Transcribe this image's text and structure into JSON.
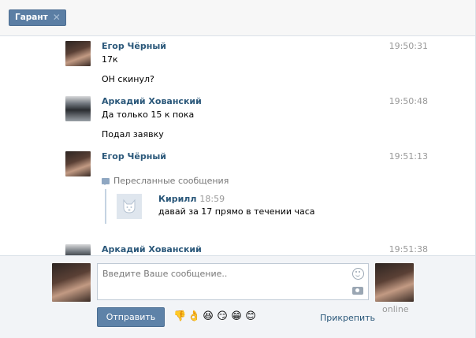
{
  "tab": {
    "label": "Гарант",
    "close_icon": "close-icon"
  },
  "messages": [
    {
      "author": "Егор Чёрный",
      "time": "19:50:31",
      "avatar": "girl-avatar",
      "lines": [
        "17к",
        "ОН скинул?"
      ]
    },
    {
      "author": "Аркадий Хованский",
      "time": "19:50:48",
      "avatar": "laptop-avatar",
      "lines": [
        "Да только 15 к пока",
        "Подал заявку"
      ]
    },
    {
      "author": "Егор Чёрный",
      "time": "19:51:13",
      "avatar": "girl-avatar",
      "forwarded": {
        "header": "Пересланные сообщения",
        "author": "Кирилл",
        "time": "18:59",
        "text": "давай за 17 прямо в течении часа"
      }
    },
    {
      "author": "Аркадий Хованский",
      "time": "19:51:38",
      "avatar": "laptop-avatar"
    }
  ],
  "composer": {
    "placeholder": "Введите Ваше сообщение..",
    "send_label": "Отправить",
    "attach_label": "Прикрепить",
    "status": "online",
    "emojis": [
      "👎",
      "👌",
      "😆",
      "😏",
      "😁",
      "😊"
    ]
  },
  "colors": {
    "accent": "#5e82a8",
    "author": "#2b587a",
    "time": "#999999"
  }
}
